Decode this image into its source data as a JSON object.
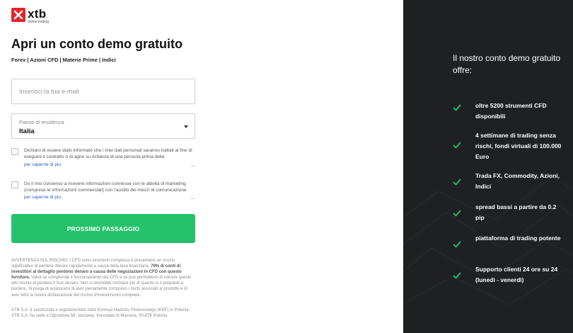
{
  "brand": {
    "name": "xtb",
    "tagline": "online trading"
  },
  "form": {
    "title": "Apri un conto demo gratuito",
    "subtitle": "Forex | Azioni CFD | Materie Prime | Indici",
    "email_placeholder": "Inserisci la tua e-mail",
    "country_label": "Paese di residenza",
    "country_value": "Italia",
    "consents": [
      {
        "text": "Dichiaro di essere stato informato che i miei dati personali saranno trattati al fine di eseguire il contratto o di agire su richiesta di una persona prima della",
        "more": "per saperne di più",
        "dots": "..."
      },
      {
        "text": "Do il mio consenso a ricevere informazioni connesse con le attività di marketing (comprese le informazioni commerciali) con l'ausilio dei mezzi di comunicazione",
        "more": "per saperne di più",
        "dots": "..."
      }
    ],
    "cta_label": "PROSSIMO PASSAGGIO",
    "warning_pre": "AVVERTENZA SUL RISCHIO: I CFD sono strumenti complessi e presentano un rischio significativo di perdere denaro rapidamente a causa della leva finanziaria. ",
    "warning_bold": "79% di conti di investitori al dettaglio perdono denaro a causa delle negoziazioni in CFD con questo fornitore.",
    "warning_post": " Valuti se comprende il funzionamento dei CFD e se può permettersi di correre questo alto rischio di perdere il Suo denaro. Non si dovrebbe rischiare più di quanto si è preparati a perdere. Si prega di assicurarsi di aver pienamente compreso i rischi associati al prodotto e di aver letto la nostra dichiarazione del rischio d'investimento completa .",
    "legal": "XTB S.A. è autorizzata e regolamentata dalla Komisja Nadzoru Finansowego (KNF) in Polonia. XTB S.A. ha sede a Ogrodowa 58, Varsavia, Voivodato di Masovia, 00-876 Polonia"
  },
  "panel": {
    "title": "Il nostro conto demo gratuito offre:",
    "features": [
      "oltre 5200 strumenti CFD disponibili",
      "4 settimane di trading senza rischi, fondi virtuali di 100.000 Euro",
      "Trada FX, Commodity, Azioni, Indici",
      "spread bassi a partire da 0.2 pip",
      "piattaforma di trading potente",
      "Supporto clienti 24 ore su 24 (lunedì - venerdì)"
    ]
  },
  "colors": {
    "accent_green": "#23c26b",
    "brand_red": "#e3242b",
    "panel_bg": "#1f2023",
    "link_blue": "#2b5fc1"
  }
}
